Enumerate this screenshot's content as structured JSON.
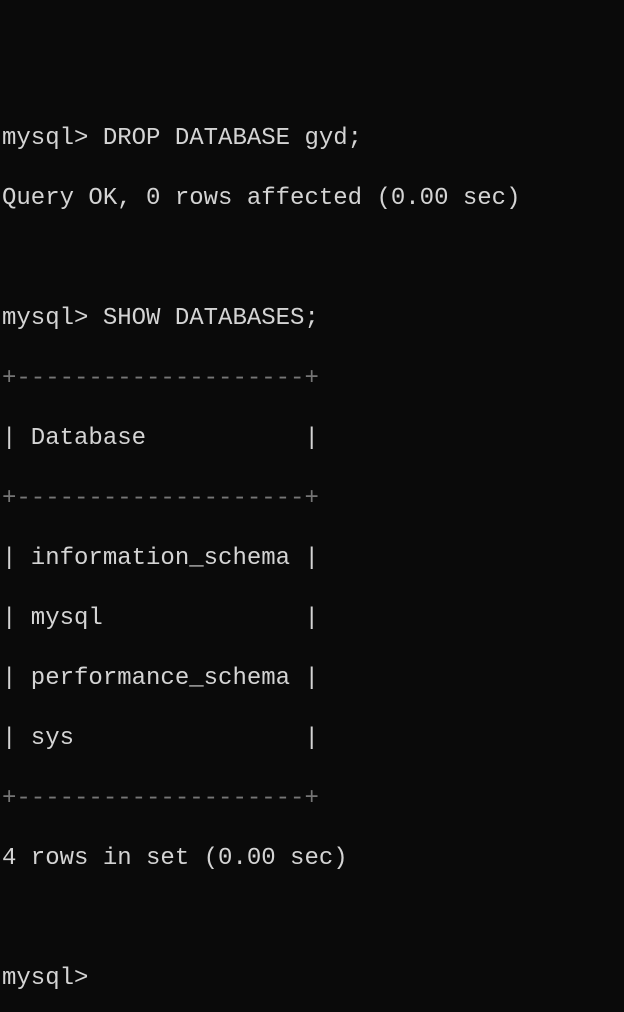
{
  "prompt_label": "mysql>",
  "cmd1": "DROP DATABASE gyd;",
  "result1": "Query OK, 0 rows affected (0.00 sec)",
  "cmd2": "SHOW DATABASES;",
  "table": {
    "border_top": "+--------------------+",
    "header": "| Database           |",
    "border_mid": "+--------------------+",
    "rows": [
      "| information_schema |",
      "| mysql              |",
      "| performance_schema |",
      "| sys                |"
    ],
    "border_bottom": "+--------------------+"
  },
  "summary": "4 rows in set (0.00 sec)",
  "prompt_final": "mysql>"
}
